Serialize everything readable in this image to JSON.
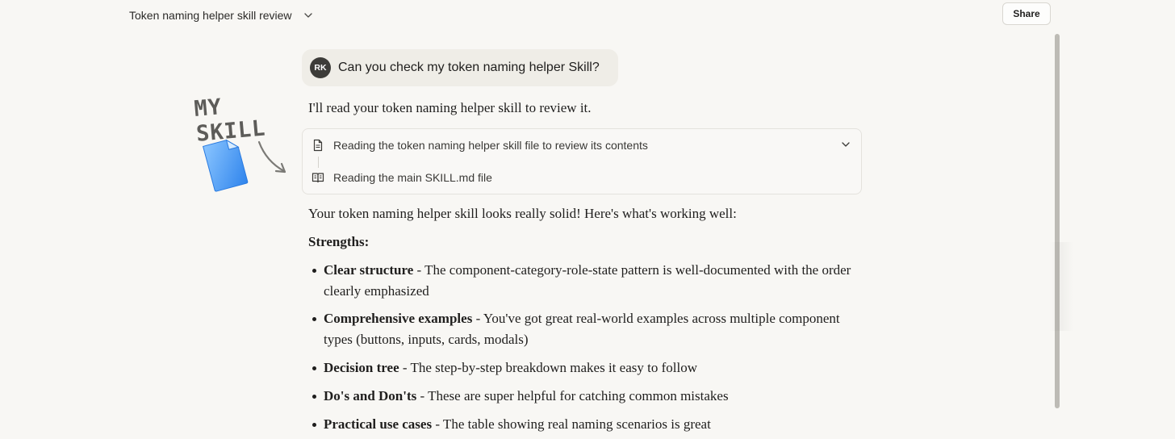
{
  "header": {
    "conversation_title": "Token naming helper skill review",
    "share_label": "Share"
  },
  "user_message": {
    "avatar_initials": "RK",
    "text": "Can you check my token naming helper Skill?"
  },
  "annotation": {
    "label": "MY SKILL"
  },
  "assistant": {
    "intro": "I'll read your token naming helper skill to review it.",
    "tool_steps": [
      {
        "icon": "document-icon",
        "text": "Reading the token naming helper skill file to review its contents"
      },
      {
        "icon": "book-icon",
        "text": "Reading the main SKILL.md file"
      }
    ],
    "summary": "Your token naming helper skill looks really solid! Here's what's working well:",
    "strengths_heading": "Strengths:",
    "strengths": [
      {
        "title": "Clear structure",
        "desc": " - The component-category-role-state pattern is well-documented with the order clearly emphasized"
      },
      {
        "title": "Comprehensive examples",
        "desc": " - You've got great real-world examples across multiple component types (buttons, inputs, cards, modals)"
      },
      {
        "title": "Decision tree",
        "desc": " - The step-by-step breakdown makes it easy to follow"
      },
      {
        "title": "Do's and Don'ts",
        "desc": " - These are super helpful for catching common mistakes"
      },
      {
        "title": "Practical use cases",
        "desc": " - The table showing real naming scenarios is great"
      }
    ]
  },
  "colors": {
    "background": "#f8f7f4",
    "user_bubble": "#efede7",
    "avatar": "#3d3c39",
    "doc_blue": "#3f95f0"
  }
}
